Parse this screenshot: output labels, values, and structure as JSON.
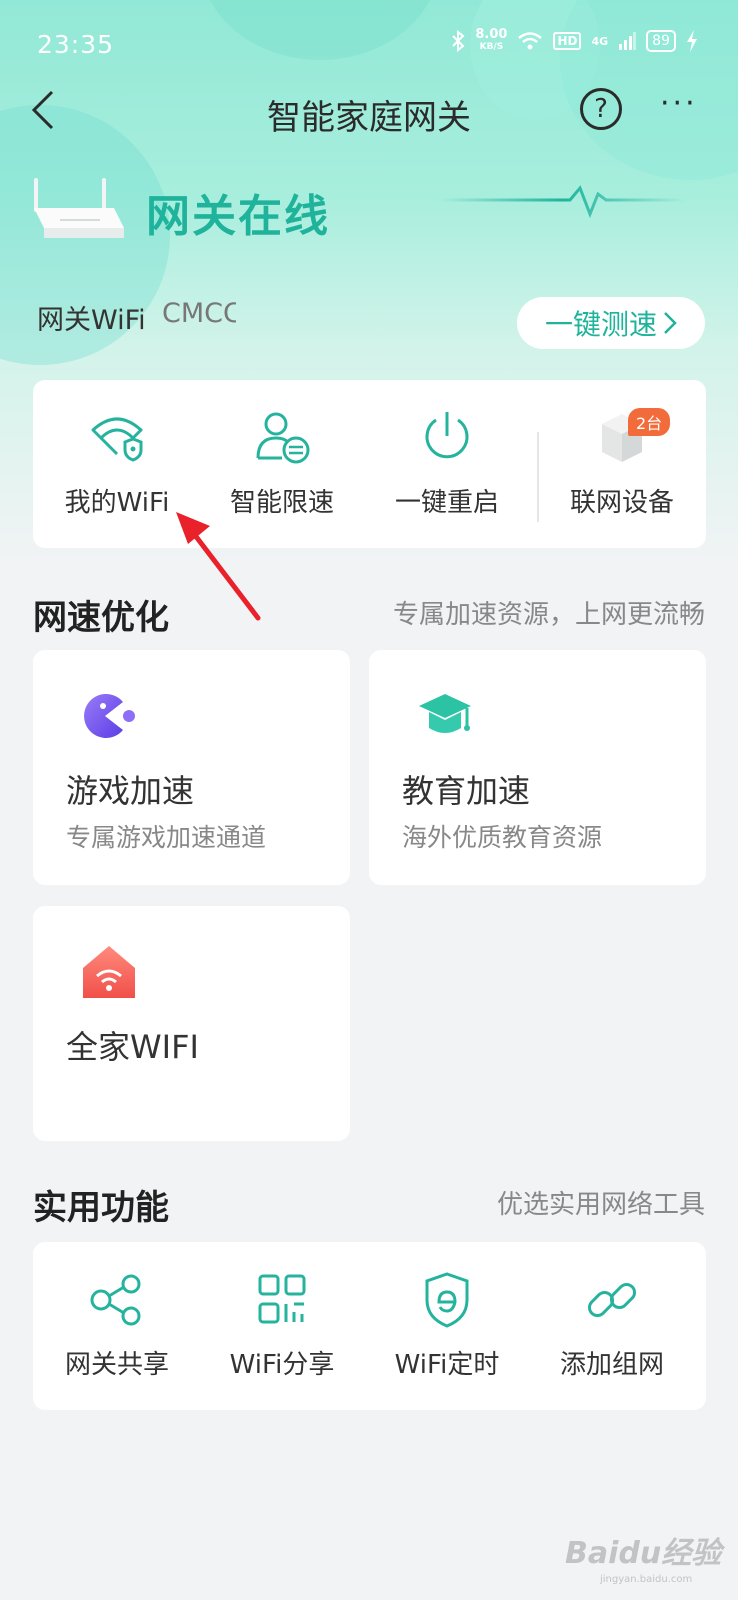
{
  "status_bar": {
    "time": "23:35",
    "net_speed_value": "8.00",
    "net_speed_unit": "KB/S",
    "hd": "HD",
    "signal": "4G",
    "battery": "89"
  },
  "nav": {
    "title": "智能家庭网关",
    "help": "?",
    "more": "···"
  },
  "gateway": {
    "status": "网关在线",
    "wifi_label": "网关WiFi",
    "wifi_ssid": "CMCC",
    "speed_test_label": "一键测速"
  },
  "quick_actions": [
    {
      "label": "我的WiFi",
      "icon": "wifi-shield-icon"
    },
    {
      "label": "智能限速",
      "icon": "user-speed-limit-icon"
    },
    {
      "label": "一键重启",
      "icon": "power-icon"
    },
    {
      "label": "联网设备",
      "icon": "device-box-icon",
      "badge": "2台"
    }
  ],
  "speed_section": {
    "title": "网速优化",
    "subtitle": "专属加速资源，上网更流畅",
    "cards": [
      {
        "title": "游戏加速",
        "subtitle": "专属游戏加速通道",
        "icon": "game-pacman-icon"
      },
      {
        "title": "教育加速",
        "subtitle": "海外优质教育资源",
        "icon": "graduation-cap-icon"
      },
      {
        "title": "全家WIFI",
        "subtitle": "",
        "icon": "home-wifi-icon"
      }
    ]
  },
  "util_section": {
    "title": "实用功能",
    "subtitle": "优选实用网络工具",
    "items": [
      {
        "label": "网关共享",
        "icon": "share-nodes-icon"
      },
      {
        "label": "WiFi分享",
        "icon": "qr-code-icon"
      },
      {
        "label": "WiFi定时",
        "icon": "shield-e-icon"
      },
      {
        "label": "添加组网",
        "icon": "link-icon"
      }
    ]
  },
  "watermark": {
    "brand": "Baidu经验",
    "url": "jingyan.baidu.com"
  },
  "colors": {
    "accent": "#1fb39c",
    "badge": "#f26b3a",
    "annotation_arrow": "#e8212b"
  }
}
